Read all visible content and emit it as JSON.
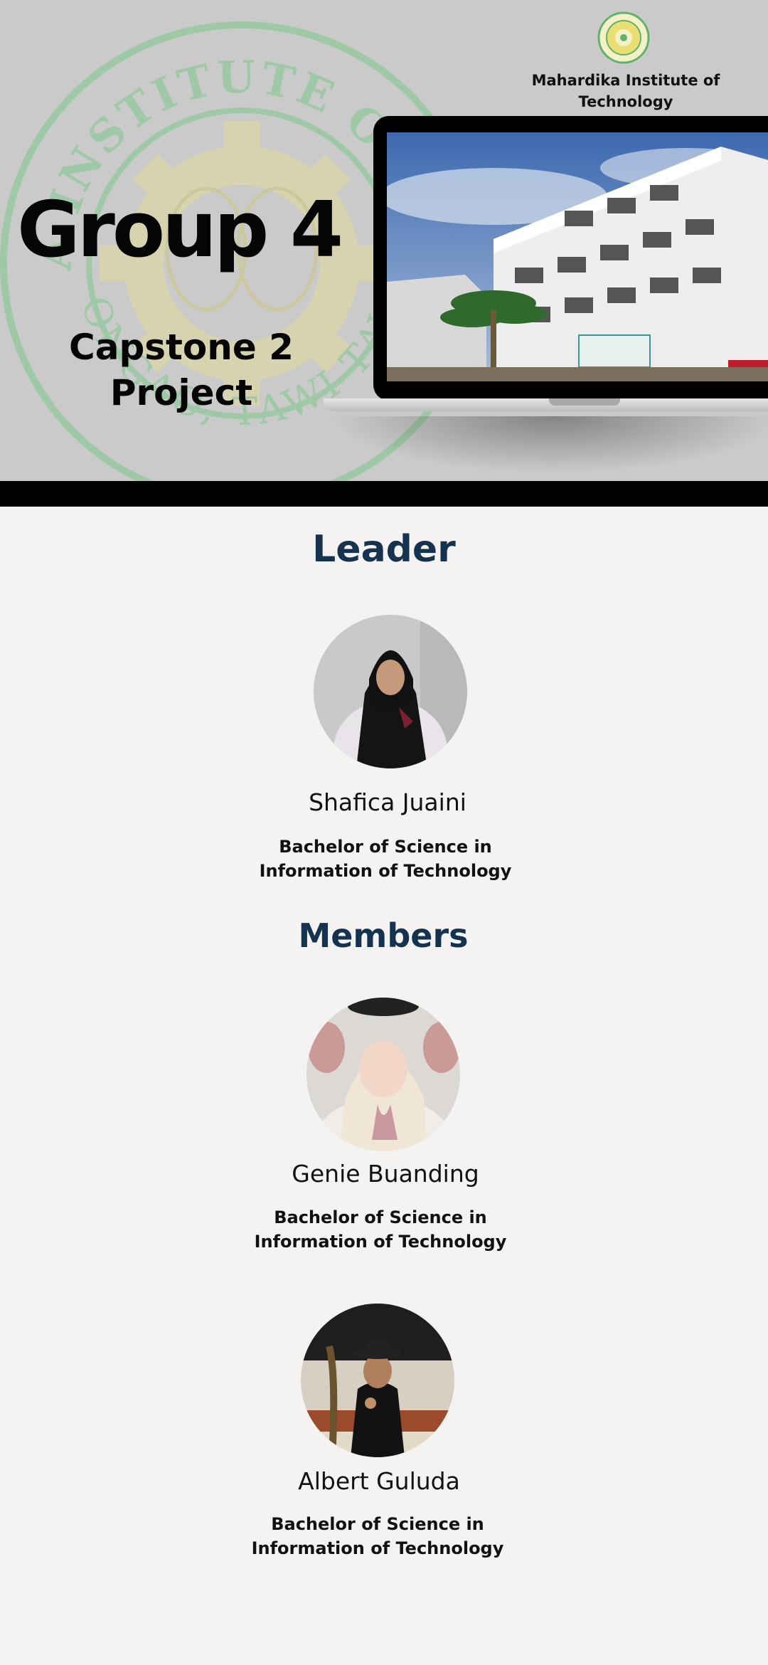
{
  "hero": {
    "institute_name_line1": "Mahardika Institute of",
    "institute_name_line2": "Technology",
    "group_title": "Group 4",
    "capstone_line1": "Capstone 2",
    "capstone_line2": "Project",
    "seal_text_top": "MAHARDIKA INSTITUTE OF TECHNOLOGY",
    "seal_text_bottom": "BONGAO, TAWI-TAWI"
  },
  "leader_section": {
    "title": "Leader",
    "leader": {
      "name": "Shafica Juaini",
      "degree_line1": "Bachelor of Science in",
      "degree_line2": "Information of Technology"
    }
  },
  "members_section": {
    "title": "Members",
    "members": [
      {
        "name": "Genie Buanding",
        "degree_line1": "Bachelor of Science in",
        "degree_line2": "Information of Technology"
      },
      {
        "name": "Albert Guluda",
        "degree_line1": "Bachelor of Science in",
        "degree_line2": "Information of Technology"
      }
    ]
  },
  "colors": {
    "hero_background": "#cacaca",
    "page_background": "#f4f3f1",
    "section_title": "#15334f",
    "seal_green": "#7cc98a",
    "seal_gear_yellow": "#e3dc9a"
  }
}
